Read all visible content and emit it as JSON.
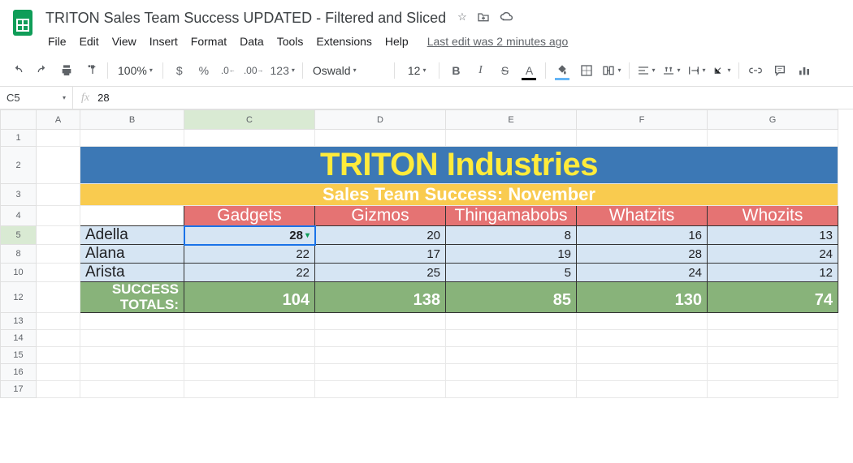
{
  "doc_title": "TRITON Sales Team Success UPDATED - Filtered and Sliced",
  "last_edit": "Last edit was 2 minutes ago",
  "menus": [
    "File",
    "Edit",
    "View",
    "Insert",
    "Format",
    "Data",
    "Tools",
    "Extensions",
    "Help"
  ],
  "toolbar": {
    "zoom": "100%",
    "dollar": "$",
    "percent": "%",
    "dec_dec": ".0",
    "dec_inc": ".00",
    "numfmt": "123",
    "font": "Oswald",
    "fontsize": "12",
    "bold": "B",
    "italic": "I",
    "strike": "S",
    "underline_a": "A"
  },
  "namebox": "C5",
  "fxlabel": "fx",
  "fxvalue": "28",
  "columns": [
    "A",
    "B",
    "C",
    "D",
    "E",
    "F",
    "G"
  ],
  "visible_row_numbers": [
    "1",
    "2",
    "3",
    "4",
    "5",
    "8",
    "10",
    "12",
    "13",
    "14",
    "15",
    "16",
    "17"
  ],
  "content": {
    "title": "TRITON Industries",
    "subtitle": "Sales Team Success: November",
    "categories": [
      "Gadgets",
      "Gizmos",
      "Thingamabobs",
      "Whatzits",
      "Whozits"
    ],
    "rows": [
      {
        "name": "Adella",
        "vals": [
          "28",
          "20",
          "8",
          "16",
          "13"
        ]
      },
      {
        "name": "Alana",
        "vals": [
          "22",
          "17",
          "19",
          "28",
          "24"
        ]
      },
      {
        "name": "Arista",
        "vals": [
          "22",
          "25",
          "5",
          "24",
          "12"
        ]
      }
    ],
    "totals_label_l1": "SUCCESS",
    "totals_label_l2": "TOTALS:",
    "totals": [
      "104",
      "138",
      "85",
      "130",
      "74"
    ]
  },
  "chart_data": {
    "type": "table",
    "title": "Sales Team Success: November",
    "categories": [
      "Gadgets",
      "Gizmos",
      "Thingamabobs",
      "Whatzits",
      "Whozits"
    ],
    "series": [
      {
        "name": "Adella",
        "values": [
          28,
          20,
          8,
          16,
          13
        ]
      },
      {
        "name": "Alana",
        "values": [
          22,
          17,
          19,
          28,
          24
        ]
      },
      {
        "name": "Arista",
        "values": [
          22,
          25,
          5,
          24,
          12
        ]
      }
    ],
    "totals": [
      104,
      138,
      85,
      130,
      74
    ]
  }
}
